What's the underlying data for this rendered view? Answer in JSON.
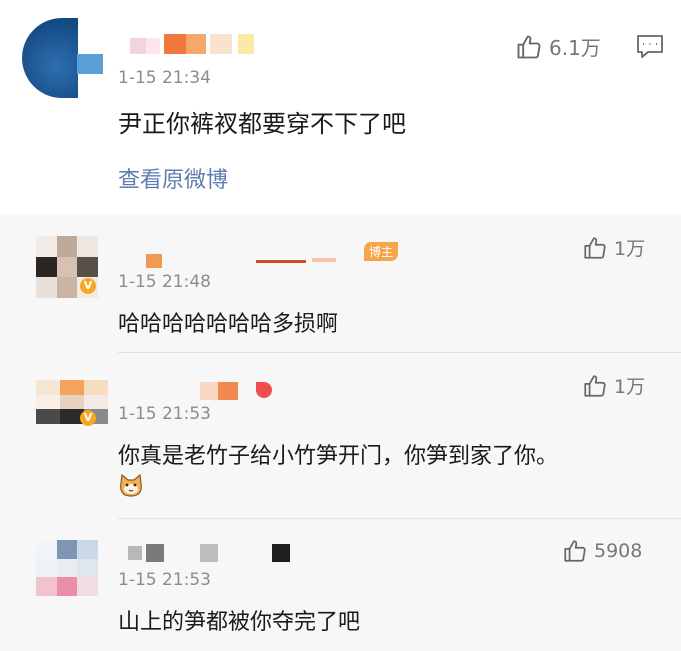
{
  "post": {
    "time": "1-15 21:34",
    "text": "尹正你裤衩都要穿不下了吧",
    "likes": "6.1万",
    "view_original": "查看原微博"
  },
  "replies": [
    {
      "time": "1-15 21:48",
      "text": "哈哈哈哈哈哈哈多损啊",
      "likes": "1万",
      "badge": "博主"
    },
    {
      "time": "1-15 21:53",
      "text": "你真是老竹子给小竹笋开门，你笋到家了你。",
      "likes": "1万"
    },
    {
      "time": "1-15 21:53",
      "text": "山上的笋都被你夺完了吧",
      "likes": "5908"
    }
  ],
  "colors": {
    "link": "#5d7eb0",
    "badge": "#f6a54a",
    "reply_bg": "#f7f7f7"
  },
  "icons": {
    "like": "thumbs-up-icon",
    "comment": "comment-icon",
    "emoji": "cat-emoji-icon"
  }
}
